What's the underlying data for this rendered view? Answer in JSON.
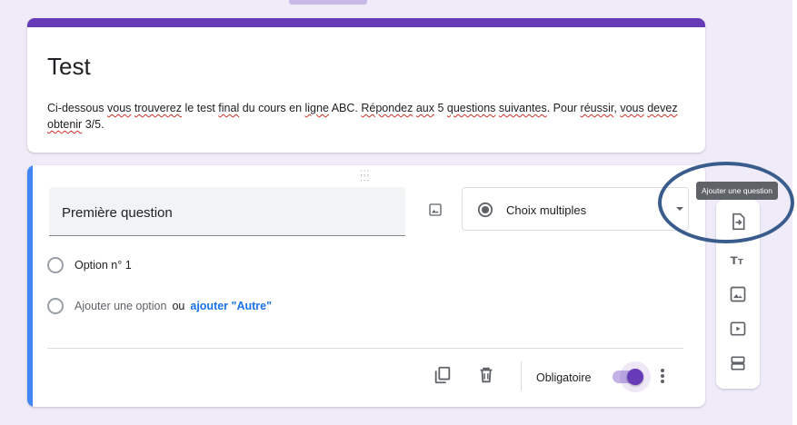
{
  "form": {
    "title": "Test",
    "description_parts": {
      "p1": "Ci-dessous ",
      "p2": "vous",
      "p3": " ",
      "p4": "trouverez",
      "p5": " le test ",
      "p6": "final",
      "p7": " du cours en ",
      "p8": "ligne",
      "p9": " ABC. ",
      "p10": "Répondez",
      "p11": " ",
      "p12": "aux",
      "p13": " 5 ",
      "p14": "questions",
      "p15": " ",
      "p16": "suivantes",
      "p17": ". Pour ",
      "p18": "réussir",
      "p19": ", ",
      "p20": "vous",
      "p21": " ",
      "p22": "devez",
      "p23": " ",
      "p24": "obtenir",
      "p25": " 3/5."
    },
    "accent_color": "#673ab7"
  },
  "question": {
    "title": "Première question",
    "type_label": "Choix multiples",
    "options": [
      {
        "label": "Option n° 1"
      }
    ],
    "add_option_label": "Ajouter une option",
    "or_label": "ou",
    "add_other_label": "ajouter \"Autre\"",
    "required_label": "Obligatoire",
    "required": true
  },
  "toolbar": {
    "tooltip": "Ajouter une question",
    "icons": [
      "import-questions-icon",
      "add-title-icon",
      "add-image-icon",
      "add-video-icon",
      "add-section-icon"
    ]
  }
}
